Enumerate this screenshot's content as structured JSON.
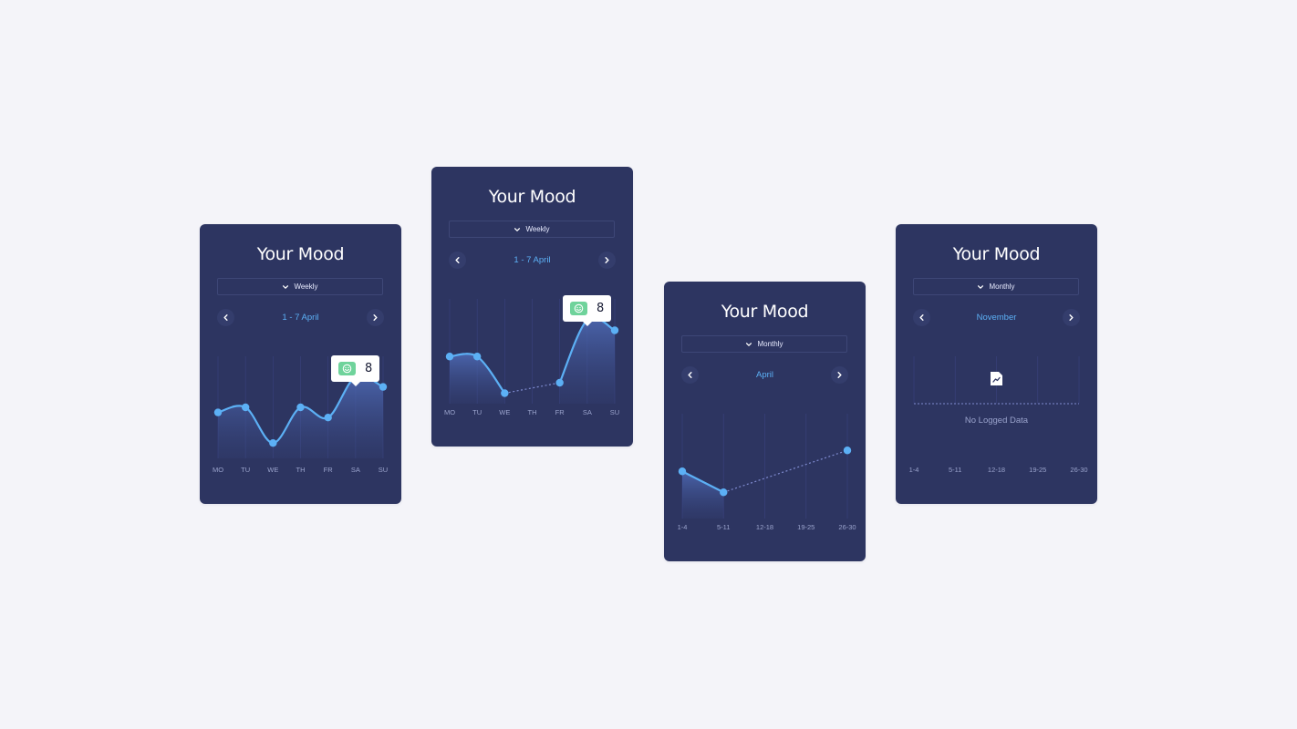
{
  "cards": [
    {
      "title": "Your Mood",
      "filter": "Weekly",
      "period": "1 - 7 April",
      "x_labels": [
        "MO",
        "TU",
        "WE",
        "TH",
        "FR",
        "SA",
        "SU"
      ],
      "tooltip_score": "8",
      "tooltip_icon": "smiley-icon"
    },
    {
      "title": "Your Mood",
      "filter": "Weekly",
      "period": "1 - 7 April",
      "x_labels": [
        "MO",
        "TU",
        "WE",
        "TH",
        "FR",
        "SA",
        "SU"
      ],
      "tooltip_score": "8",
      "tooltip_icon": "smiley-icon"
    },
    {
      "title": "Your Mood",
      "filter": "Monthly",
      "period": "April",
      "x_labels": [
        "1-4",
        "5-11",
        "12-18",
        "19-25",
        "26-30"
      ]
    },
    {
      "title": "Your Mood",
      "filter": "Monthly",
      "period": "November",
      "x_labels": [
        "1-4",
        "5-11",
        "12-18",
        "19-25",
        "26-30"
      ],
      "empty_text": "No Logged Data",
      "empty_icon": "chart-document-icon"
    }
  ],
  "colors": {
    "background": "#f4f4f9",
    "card": "#2d3561",
    "accent": "#5cb0f5",
    "tooltip_face": "#6fd39b"
  },
  "chart_data": [
    {
      "type": "line",
      "categories": [
        "MO",
        "TU",
        "WE",
        "TH",
        "FR",
        "SA",
        "SU"
      ],
      "series": [
        {
          "values": [
            4.5,
            5,
            1.5,
            5,
            4,
            8,
            7
          ]
        }
      ],
      "ylim": [
        0,
        10
      ]
    },
    {
      "type": "line",
      "categories": [
        "MO",
        "TU",
        "WE",
        "TH",
        "FR",
        "SA",
        "SU"
      ],
      "series": [
        {
          "values": [
            4.5,
            4.5,
            1,
            null,
            2,
            8,
            7
          ]
        }
      ],
      "ylim": [
        0,
        10
      ]
    },
    {
      "type": "line",
      "categories": [
        "1-4",
        "5-11",
        "12-18",
        "19-25",
        "26-30"
      ],
      "series": [
        {
          "values": [
            4.5,
            2.5,
            null,
            null,
            6.5
          ]
        }
      ],
      "ylim": [
        0,
        10
      ]
    },
    {
      "type": "line",
      "categories": [
        "1-4",
        "5-11",
        "12-18",
        "19-25",
        "26-30"
      ],
      "series": [
        {
          "values": [
            null,
            null,
            null,
            null,
            null
          ]
        }
      ],
      "ylim": [
        0,
        10
      ]
    }
  ]
}
